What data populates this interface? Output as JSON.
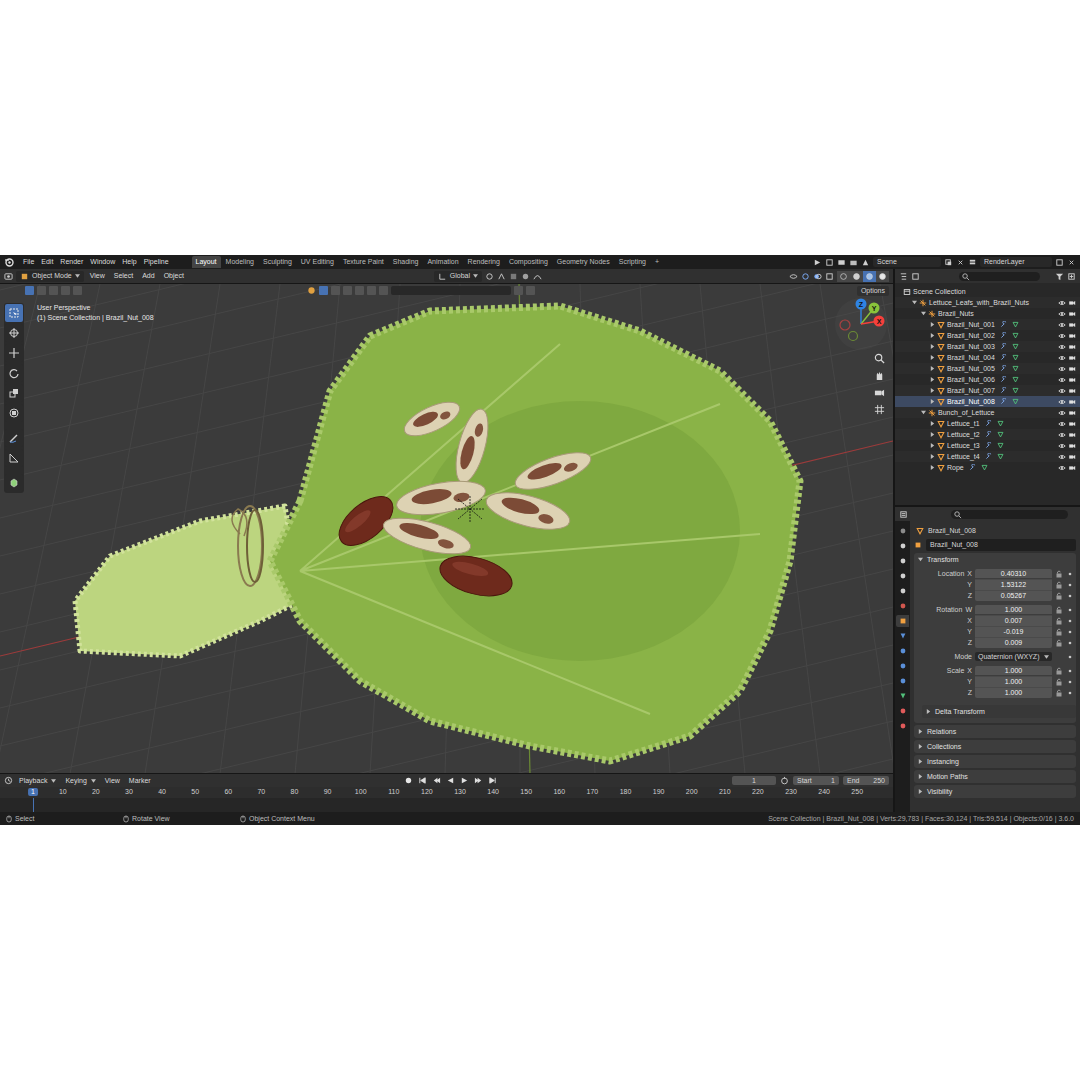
{
  "topbar": {
    "menus": [
      "File",
      "Edit",
      "Render",
      "Window",
      "Help",
      "Pipeline"
    ],
    "workspaces": [
      {
        "label": "Layout",
        "selected": true
      },
      {
        "label": "Modeling",
        "selected": false
      },
      {
        "label": "Sculpting",
        "selected": false
      },
      {
        "label": "UV Editing",
        "selected": false
      },
      {
        "label": "Texture Paint",
        "selected": false
      },
      {
        "label": "Shading",
        "selected": false
      },
      {
        "label": "Animation",
        "selected": false
      },
      {
        "label": "Rendering",
        "selected": false
      },
      {
        "label": "Compositing",
        "selected": false
      },
      {
        "label": "Geometry Nodes",
        "selected": false
      },
      {
        "label": "Scripting",
        "selected": false
      }
    ],
    "add_tab": "+",
    "scene": "Scene",
    "view_layer": "RenderLayer"
  },
  "viewport_header": {
    "mode": "Object Mode",
    "menus": [
      "View",
      "Select",
      "Add",
      "Object"
    ],
    "orientation": "Global",
    "options": "Options",
    "shading": [
      {
        "kind": "wireframe",
        "selected": false
      },
      {
        "kind": "solid",
        "selected": false
      },
      {
        "kind": "material",
        "selected": true
      },
      {
        "kind": "rendered",
        "selected": false
      }
    ]
  },
  "viewport": {
    "view_name": "User Perspective",
    "context": "(1) Scene Collection | Brazil_Nut_008",
    "gizmo": [
      {
        "axis": "Z",
        "color": "#2f83e3"
      },
      {
        "axis": "Y",
        "color": "#8ac33b"
      },
      {
        "axis": "X",
        "color": "#f5403b"
      }
    ],
    "toolbar": [
      {
        "kind": "select",
        "selected": true
      },
      {
        "kind": "cursor",
        "selected": false
      },
      {
        "kind": "move",
        "selected": false
      },
      {
        "kind": "rotate",
        "selected": false
      },
      {
        "kind": "scale",
        "selected": false
      },
      {
        "kind": "transform",
        "selected": false
      },
      {
        "kind": "annotate",
        "selected": false
      },
      {
        "kind": "measure",
        "selected": false
      },
      {
        "kind": "add",
        "selected": false
      }
    ]
  },
  "outliner": {
    "items": [
      {
        "label": "Scene Collection",
        "depth": 0,
        "kind": "scene_collection",
        "expanded": true,
        "selected": false
      },
      {
        "label": "Lettuce_Leafs_with_Brazil_Nuts",
        "depth": 1,
        "kind": "empty",
        "expanded": true,
        "selected": false
      },
      {
        "label": "Brazil_Nuts",
        "depth": 2,
        "kind": "empty",
        "expanded": true,
        "selected": false
      },
      {
        "label": "Brazil_Nut_001",
        "depth": 3,
        "kind": "mesh",
        "expanded": false,
        "selected": false
      },
      {
        "label": "Brazil_Nut_002",
        "depth": 3,
        "kind": "mesh",
        "expanded": false,
        "selected": false
      },
      {
        "label": "Brazil_Nut_003",
        "depth": 3,
        "kind": "mesh",
        "expanded": false,
        "selected": false
      },
      {
        "label": "Brazil_Nut_004",
        "depth": 3,
        "kind": "mesh",
        "expanded": false,
        "selected": false
      },
      {
        "label": "Brazil_Nut_005",
        "depth": 3,
        "kind": "mesh",
        "expanded": false,
        "selected": false
      },
      {
        "label": "Brazil_Nut_006",
        "depth": 3,
        "kind": "mesh",
        "expanded": false,
        "selected": false
      },
      {
        "label": "Brazil_Nut_007",
        "depth": 3,
        "kind": "mesh",
        "expanded": false,
        "selected": false
      },
      {
        "label": "Brazil_Nut_008",
        "depth": 3,
        "kind": "mesh",
        "expanded": false,
        "selected": true
      },
      {
        "label": "Bunch_of_Lettuce",
        "depth": 2,
        "kind": "empty",
        "expanded": true,
        "selected": false
      },
      {
        "label": "Lettuce_t1",
        "depth": 3,
        "kind": "mesh",
        "expanded": false,
        "selected": false
      },
      {
        "label": "Lettuce_t2",
        "depth": 3,
        "kind": "mesh",
        "expanded": false,
        "selected": false
      },
      {
        "label": "Lettuce_t3",
        "depth": 3,
        "kind": "mesh",
        "expanded": false,
        "selected": false
      },
      {
        "label": "Lettuce_t4",
        "depth": 3,
        "kind": "mesh",
        "expanded": false,
        "selected": false
      },
      {
        "label": "Rope",
        "depth": 3,
        "kind": "mesh",
        "expanded": false,
        "selected": false
      }
    ]
  },
  "properties": {
    "tabs": [
      {
        "kind": "tool",
        "selected": false
      },
      {
        "kind": "render",
        "selected": false
      },
      {
        "kind": "output",
        "selected": false
      },
      {
        "kind": "view_layer",
        "selected": false
      },
      {
        "kind": "scene",
        "selected": false
      },
      {
        "kind": "world",
        "selected": false
      },
      {
        "kind": "object",
        "selected": true
      },
      {
        "kind": "modifiers",
        "selected": false
      },
      {
        "kind": "particles",
        "selected": false
      },
      {
        "kind": "physics",
        "selected": false
      },
      {
        "kind": "constraints",
        "selected": false
      },
      {
        "kind": "data",
        "selected": false
      },
      {
        "kind": "material",
        "selected": false
      },
      {
        "kind": "texture",
        "selected": false
      }
    ],
    "context": "Brazil_Nut_008",
    "name": "Brazil_Nut_008",
    "transform": {
      "title": "Transform",
      "expanded": true,
      "rows": [
        {
          "kind": "vector",
          "label": "Location",
          "fields": [
            {
              "axis": "X",
              "value": "0.40310"
            },
            {
              "axis": "Y",
              "value": "1.53122"
            },
            {
              "axis": "Z",
              "value": "0.05267"
            }
          ]
        },
        {
          "kind": "vector",
          "label": "Rotation",
          "fields": [
            {
              "axis": "W",
              "value": "1.000"
            },
            {
              "axis": "X",
              "value": "0.007"
            },
            {
              "axis": "Y",
              "value": "-0.019"
            },
            {
              "axis": "Z",
              "value": "0.009"
            }
          ]
        },
        {
          "kind": "enum",
          "label": "Mode",
          "value": "Quaternion (WXYZ)"
        },
        {
          "kind": "vector",
          "label": "Scale",
          "fields": [
            {
              "axis": "X",
              "value": "1.000"
            },
            {
              "axis": "Y",
              "value": "1.000"
            },
            {
              "axis": "Z",
              "value": "1.000"
            }
          ]
        }
      ],
      "subpanels": [
        {
          "label": "Delta Transform",
          "expanded": false
        }
      ]
    },
    "panels": [
      {
        "label": "Relations",
        "expanded": false
      },
      {
        "label": "Collections",
        "expanded": false
      },
      {
        "label": "Instancing",
        "expanded": false
      },
      {
        "label": "Motion Paths",
        "expanded": false
      },
      {
        "label": "Visibility",
        "expanded": false
      }
    ]
  },
  "timeline": {
    "menus": [
      "Playback",
      "Keying",
      "View",
      "Marker"
    ],
    "current_frame": "1",
    "start_label": "Start",
    "start": "1",
    "end_label": "End",
    "end": "250",
    "ruler": [
      {
        "label": "1",
        "selected": true
      },
      {
        "label": "10",
        "selected": false
      },
      {
        "label": "20",
        "selected": false
      },
      {
        "label": "30",
        "selected": false
      },
      {
        "label": "40",
        "selected": false
      },
      {
        "label": "50",
        "selected": false
      },
      {
        "label": "60",
        "selected": false
      },
      {
        "label": "70",
        "selected": false
      },
      {
        "label": "80",
        "selected": false
      },
      {
        "label": "90",
        "selected": false
      },
      {
        "label": "100",
        "selected": false
      },
      {
        "label": "110",
        "selected": false
      },
      {
        "label": "120",
        "selected": false
      },
      {
        "label": "130",
        "selected": false
      },
      {
        "label": "140",
        "selected": false
      },
      {
        "label": "150",
        "selected": false
      },
      {
        "label": "160",
        "selected": false
      },
      {
        "label": "170",
        "selected": false
      },
      {
        "label": "180",
        "selected": false
      },
      {
        "label": "190",
        "selected": false
      },
      {
        "label": "200",
        "selected": false
      },
      {
        "label": "210",
        "selected": false
      },
      {
        "label": "220",
        "selected": false
      },
      {
        "label": "230",
        "selected": false
      },
      {
        "label": "240",
        "selected": false
      },
      {
        "label": "250",
        "selected": false
      }
    ]
  },
  "status_bar": {
    "hints": [
      "Select",
      "Rotate View",
      "Object Context Menu"
    ],
    "stats": "Scene Collection | Brazil_Nut_008 | Verts:29,783 | Faces:30,124 | Tris:59,514 | Objects:0/16 | 3.6.0"
  }
}
